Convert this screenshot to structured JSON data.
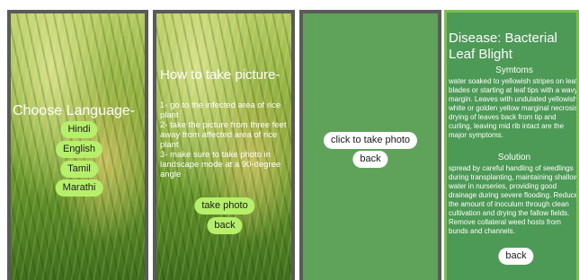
{
  "panel1": {
    "heading": "Choose Language-",
    "languages": [
      "Hindi",
      "English",
      "Tamil",
      "Marathi"
    ]
  },
  "panel2": {
    "title": "How to take picture-",
    "steps": "1- go to the infected area of rice plant\n2- take the picture from three feet away from affected area of rice plant\n3- make sure to take photo in landscape mode at a 90-degree angle",
    "take_photo": "take photo",
    "back": "back"
  },
  "panel3": {
    "click_label": "click to take photo",
    "back": "back"
  },
  "panel4": {
    "disease_title": "Disease: Bacterial Leaf Blight",
    "symptoms_heading": "Symtoms",
    "symptoms_text": "water soaked to yellowish stripes on leaf blades or starting at leaf tips with a wavy margin. Leaves with undulated yellowish white or golden yellow marginal necrosis, drying of leaves back from tip and curling, leaving mid rib intact are the major symptoms.",
    "solution_heading": "Solution",
    "solution_text": "spread by careful handling of seedlings during transplanting, maintaining shallow water in nurseries, providing good drainage during severe flooding. Reduce the amount of inoculum through clean cultivation and drying the fallow fields. Remove collateral weed hosts from bunds and channels.",
    "back": "back"
  },
  "colors": {
    "pill_green": "#b6f06a",
    "panel_green": "#5fa35a",
    "panel4_green": "#4c9a55",
    "border_dark": "#5a5a5a",
    "border_green": "#7cbf4d"
  }
}
